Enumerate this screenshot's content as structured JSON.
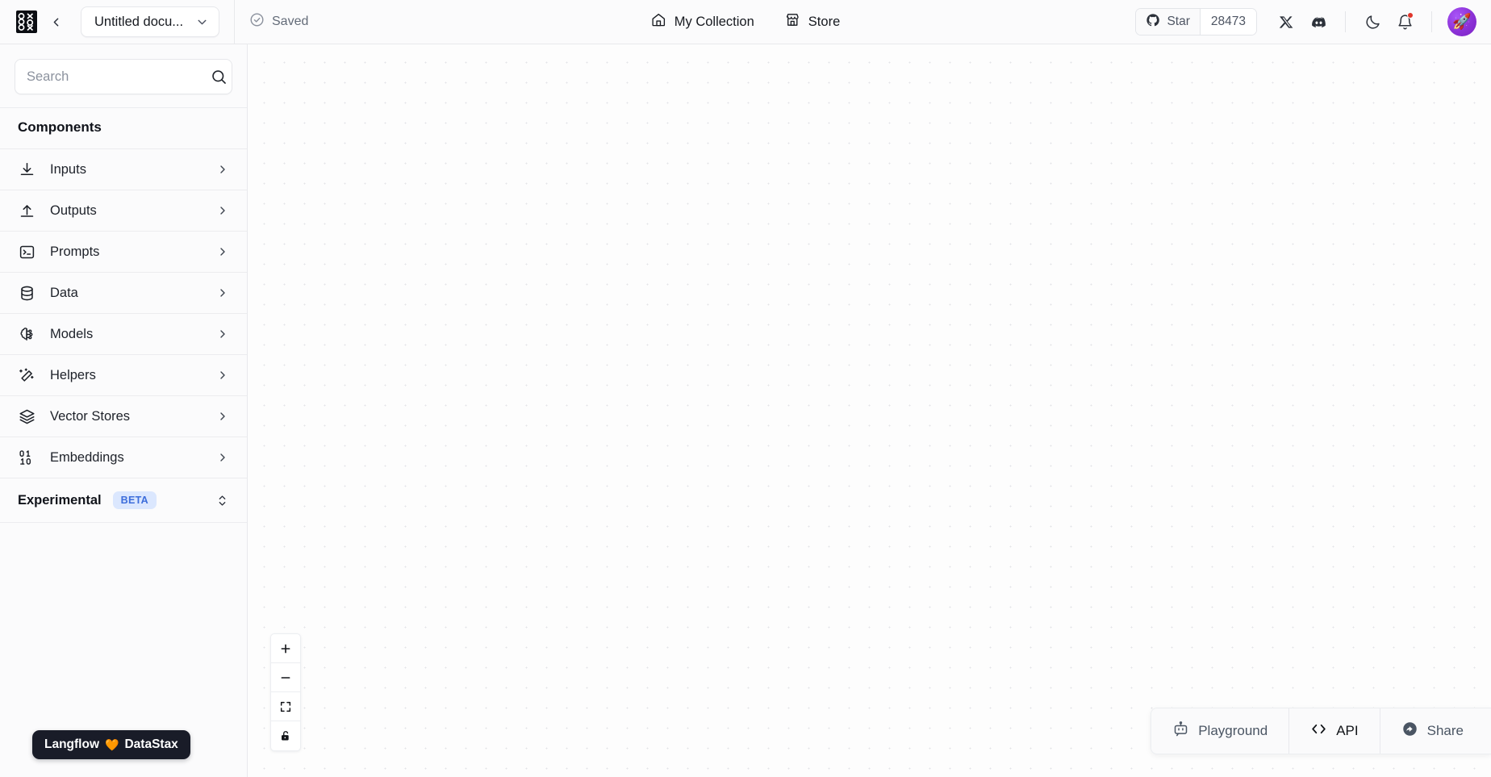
{
  "header": {
    "logo_icon": "langflow-logo-icon",
    "back_icon": "chevron-left-icon",
    "document_title": "Untitled docu...",
    "document_chevron_icon": "chevron-down-icon",
    "save_status": "Saved",
    "save_status_icon": "check-circle-icon",
    "nav": [
      {
        "label": "My Collection",
        "icon": "home-icon"
      },
      {
        "label": "Store",
        "icon": "store-icon"
      }
    ],
    "github": {
      "icon": "github-icon",
      "star_label": "Star",
      "star_count": "28473"
    },
    "social": [
      {
        "name": "x-twitter-icon"
      },
      {
        "name": "discord-icon"
      }
    ],
    "theme_toggle_icon": "moon-icon",
    "notifications_icon": "bell-icon",
    "notifications_has_unread": true,
    "avatar_icon": "rocket-avatar",
    "avatar_emoji": "🚀"
  },
  "sidebar": {
    "search": {
      "placeholder": "Search",
      "value": "",
      "icon": "search-icon"
    },
    "section_title": "Components",
    "categories": [
      {
        "label": "Inputs",
        "icon": "download-icon",
        "chevron": "chevron-right-icon"
      },
      {
        "label": "Outputs",
        "icon": "upload-icon",
        "chevron": "chevron-right-icon"
      },
      {
        "label": "Prompts",
        "icon": "terminal-icon",
        "chevron": "chevron-right-icon"
      },
      {
        "label": "Data",
        "icon": "database-icon",
        "chevron": "chevron-right-icon"
      },
      {
        "label": "Models",
        "icon": "brain-circuit-icon",
        "chevron": "chevron-right-icon"
      },
      {
        "label": "Helpers",
        "icon": "magic-wand-icon",
        "chevron": "chevron-right-icon"
      },
      {
        "label": "Vector Stores",
        "icon": "layers-icon",
        "chevron": "chevron-right-icon"
      },
      {
        "label": "Embeddings",
        "icon": "binary-icon",
        "chevron": "chevron-right-icon"
      }
    ],
    "experimental": {
      "label": "Experimental",
      "badge": "BETA",
      "badge_color": "#3c6ddb",
      "badge_bg": "#dbe7fe",
      "chevron": "chevrons-up-down-icon"
    },
    "footer_badge": {
      "left_text": "Langflow",
      "heart": "🧡",
      "right_text": "DataStax"
    }
  },
  "canvas": {
    "zoom_controls": [
      {
        "name": "zoom-in",
        "icon": "plus-icon"
      },
      {
        "name": "zoom-out",
        "icon": "minus-icon"
      },
      {
        "name": "fit-view",
        "icon": "maximize-icon"
      },
      {
        "name": "lock-toggle",
        "icon": "unlock-icon"
      }
    ],
    "actions": [
      {
        "label": "Playground",
        "icon": "bot-icon"
      },
      {
        "label": "API",
        "icon": "code-icon"
      },
      {
        "label": "Share",
        "icon": "share-icon"
      }
    ]
  }
}
